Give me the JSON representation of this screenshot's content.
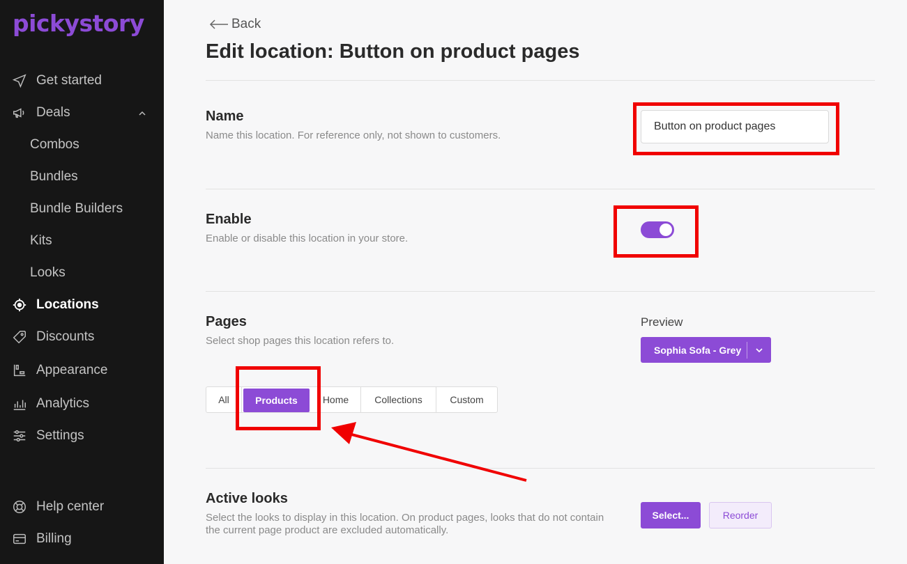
{
  "sidebar": {
    "logo": "pickystory",
    "items": [
      {
        "label": "Get started"
      },
      {
        "label": "Deals"
      },
      {
        "label": "Combos"
      },
      {
        "label": "Bundles"
      },
      {
        "label": "Bundle Builders"
      },
      {
        "label": "Kits"
      },
      {
        "label": "Looks"
      },
      {
        "label": "Locations"
      },
      {
        "label": "Discounts"
      },
      {
        "label": "Appearance"
      },
      {
        "label": "Analytics"
      },
      {
        "label": "Settings"
      }
    ],
    "footer": [
      {
        "label": "Help center"
      },
      {
        "label": "Billing"
      }
    ]
  },
  "main": {
    "back_label": "Back",
    "title": "Edit location: Button on product pages",
    "name": {
      "title": "Name",
      "desc": "Name this location. For reference only, not shown to customers.",
      "value": "Button on product pages"
    },
    "enable": {
      "title": "Enable",
      "desc": "Enable or disable this location in your store.",
      "enabled": true
    },
    "pages": {
      "title": "Pages",
      "desc": "Select shop pages this location refers to.",
      "tabs": [
        "All",
        "Products",
        "Home",
        "Collections",
        "Custom"
      ],
      "active_tab": "Products",
      "preview_label": "Preview",
      "preview_value": "Sophia Sofa - Grey"
    },
    "active_looks": {
      "title": "Active looks",
      "desc_line1": "Select the looks to display in this location. On product pages, looks that do not contain",
      "desc_line2": "the current page product are excluded automatically.",
      "select_label": "Select...",
      "reorder_label": "Reorder"
    }
  },
  "colors": {
    "accent": "#8c4bd6",
    "highlight": "#f00000",
    "sidebar_bg": "#161616"
  }
}
